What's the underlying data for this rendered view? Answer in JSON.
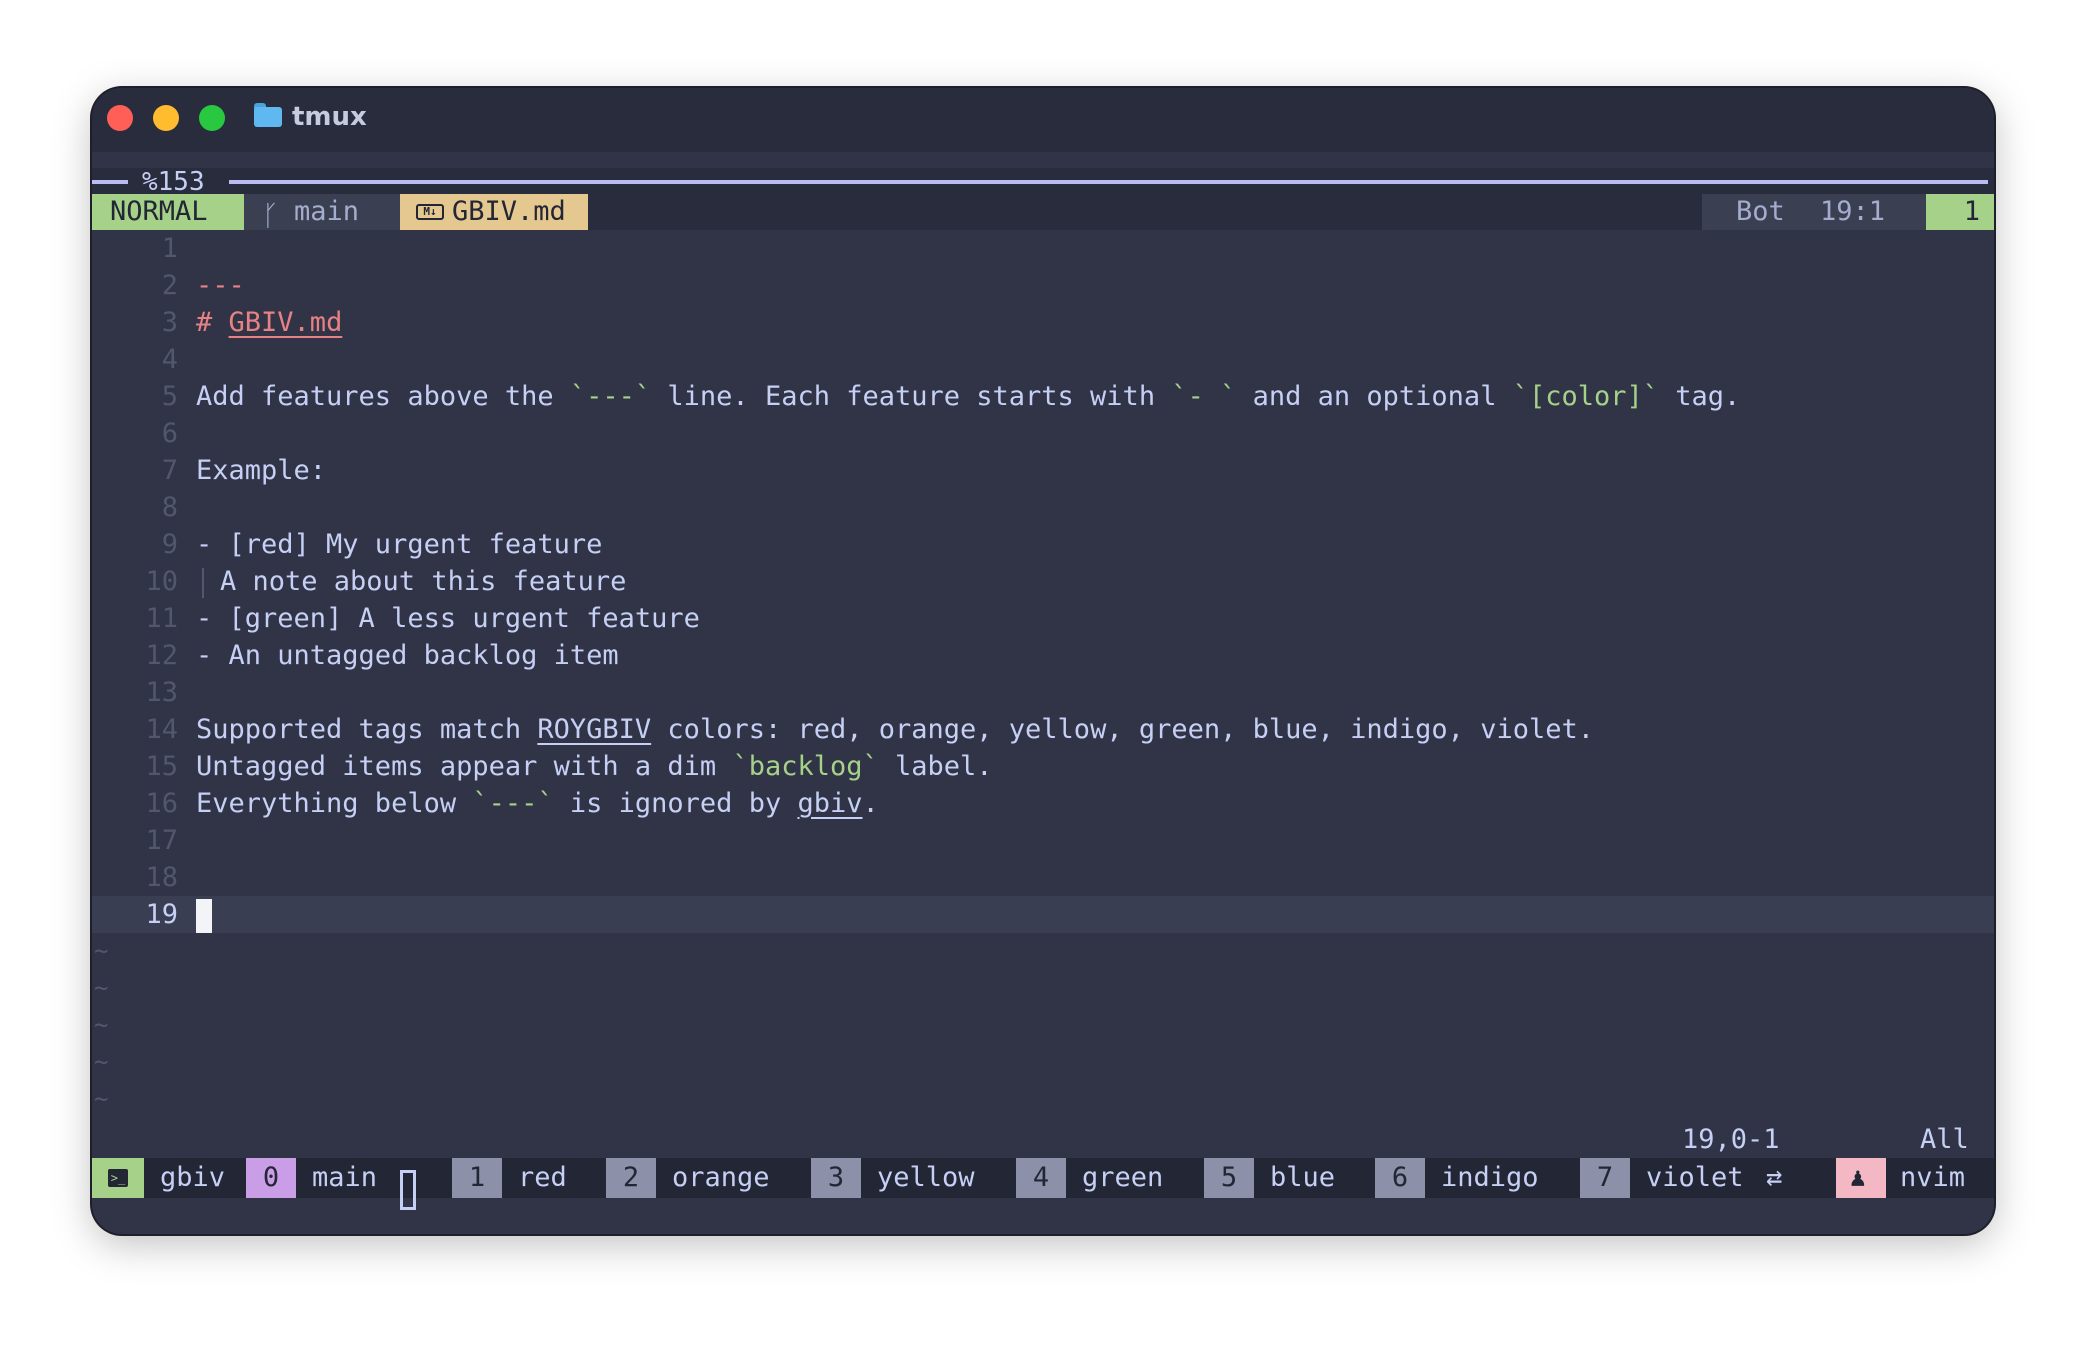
{
  "window": {
    "title": "tmux",
    "pane_id": "%153"
  },
  "statusline": {
    "mode": "NORMAL",
    "branch": "main",
    "filetype_icon": "markdown-icon",
    "file": "GBIV.md",
    "scroll": "Bot",
    "position": "19:1",
    "count": "1"
  },
  "editor": {
    "lines": [
      {
        "n": "1",
        "text": ""
      },
      {
        "n": "2",
        "text": "---"
      },
      {
        "n": "3",
        "hash": "#",
        "heading": "GBIV.md"
      },
      {
        "n": "4",
        "text": ""
      },
      {
        "n": "5",
        "p1": "Add features above the ",
        "c1": "`---`",
        "p2": " line. Each feature starts with ",
        "c2": "`- `",
        "p3": " and an optional ",
        "c3": "`[color]`",
        "p4": " tag."
      },
      {
        "n": "6",
        "text": ""
      },
      {
        "n": "7",
        "text": "Example:"
      },
      {
        "n": "8",
        "text": ""
      },
      {
        "n": "9",
        "text": "- [red] My urgent feature"
      },
      {
        "n": "10",
        "text": "A note about this feature"
      },
      {
        "n": "11",
        "text": "- [green] A less urgent feature"
      },
      {
        "n": "12",
        "text": "- An untagged backlog item"
      },
      {
        "n": "13",
        "text": ""
      },
      {
        "n": "14",
        "p1": "Supported tags match ",
        "u1": "ROYGBIV",
        "p2": " colors: red, orange, yellow, green, blue, indigo, violet."
      },
      {
        "n": "15",
        "p1": "Untagged items appear with a dim ",
        "c1": "`backlog`",
        "p2": " label."
      },
      {
        "n": "16",
        "p1": "Everything below ",
        "c1": "`---`",
        "p2": " is ignored by ",
        "u1": "gbiv",
        "p3": "."
      },
      {
        "n": "17",
        "text": ""
      },
      {
        "n": "18",
        "text": ""
      },
      {
        "n": "19",
        "text": ""
      }
    ],
    "tilde": "~"
  },
  "cmdline": {
    "ruler": "19,0-1",
    "scroll": "All"
  },
  "tmux": {
    "session": "gbiv",
    "windows": [
      {
        "index": "0",
        "name": "main",
        "active": true
      },
      {
        "index": "1",
        "name": "red"
      },
      {
        "index": "2",
        "name": "orange"
      },
      {
        "index": "3",
        "name": "yellow"
      },
      {
        "index": "4",
        "name": "green"
      },
      {
        "index": "5",
        "name": "blue"
      },
      {
        "index": "6",
        "name": "indigo"
      },
      {
        "index": "7",
        "name": "violet"
      }
    ],
    "process": "nvim"
  },
  "colors": {
    "background": "#303446",
    "accent_green": "#a6d189",
    "accent_yellow": "#e5c890",
    "accent_mauve": "#ca9ee6",
    "accent_pink": "#f4b8c4",
    "heading_red": "#e78284"
  }
}
